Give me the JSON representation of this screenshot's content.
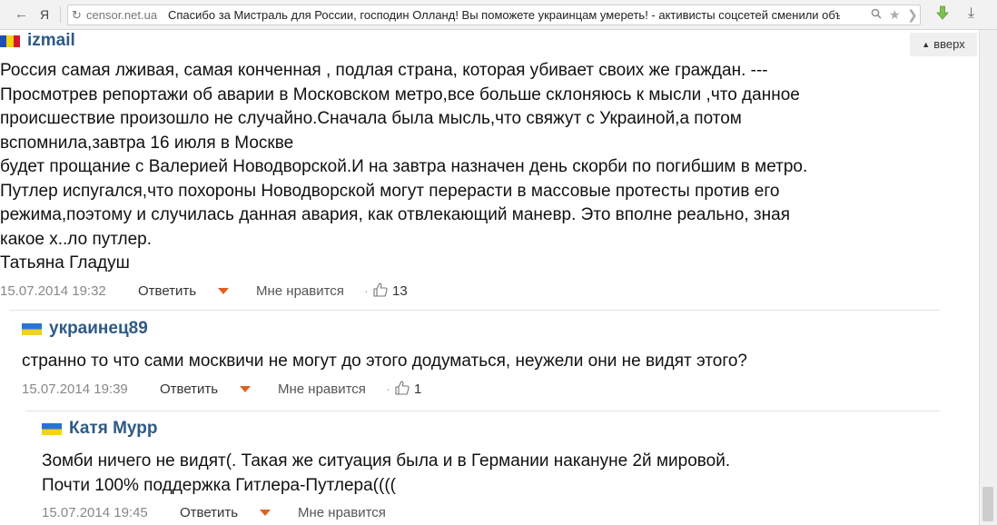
{
  "browser": {
    "back": "←",
    "yandex": "Я",
    "reload": "↻",
    "host": "censor.net.ua",
    "title": "Спасибо за Мистраль для России, господин Олланд! Вы поможете украинцам умереть! - активисты соцсетей сменили объек...",
    "search_icon": "search-icon",
    "star_icon": "star-icon",
    "arrow": "❯",
    "download": "⤓"
  },
  "up_button": {
    "label": "вверх"
  },
  "comments": [
    {
      "author": "izmail",
      "flag": "moldova",
      "lines": [
        "Россия самая лживая, самая конченная , подлая страна, которая убивает своих же граждан. ---",
        "Просмотрев репортажи об аварии в Московском метро,все больше склоняюсь к мысли ,что данное",
        "происшествие произошло не случайно.Сначала была мысль,что свяжут с Украиной,а потом",
        "вспомнила,завтра 16 июля в Москве",
        "будет прощание с Валерией Новодворской.И на завтра назначен день скорби по погибшим в метро.",
        "Путлер испугался,что похороны Новодворской могут перерасти в массовые протесты против его",
        "режима,поэтому и случилась данная авария, как отвлекающий маневр. Это вполне реально, зная",
        "какое х..ло путлер.",
        "Татьяна Гладуш"
      ],
      "date": "15.07.2014 19:32",
      "reply": "Ответить",
      "like": "Мне нравится",
      "likes": "13"
    },
    {
      "author": "украинец89",
      "flag": "ukraine",
      "lines": [
        "странно то что сами москвичи не могут до этого додуматься, неужели они не видят этого?"
      ],
      "date": "15.07.2014 19:39",
      "reply": "Ответить",
      "like": "Мне нравится",
      "likes": "1"
    },
    {
      "author": "Катя Мурр",
      "flag": "ukraine",
      "lines": [
        "Зомби ничего не видят(. Такая же ситуация была и в Германии накануне 2й мировой.",
        "Почти 100% поддержка Гитлера-Путлера(((("
      ],
      "date": "15.07.2014 19:45",
      "reply": "Ответить",
      "like": "Мне нравится"
    }
  ],
  "colors": {
    "author": "#2e5a86",
    "reply_arrow": "#e06020",
    "meta": "#888888"
  }
}
